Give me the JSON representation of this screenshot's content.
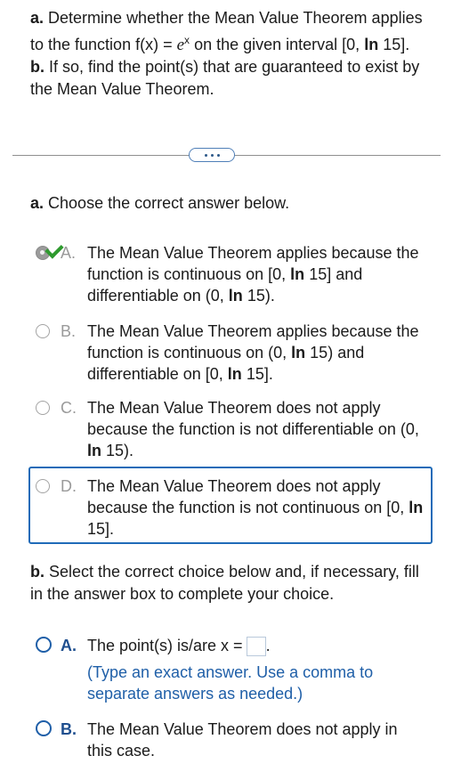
{
  "question": {
    "a_label": "a.",
    "a_text_1": "Determine whether the Mean Value Theorem applies to the function f(x) =",
    "a_func_base": "e",
    "a_func_exp": "x",
    "a_text_2": "on the given interval [0,",
    "a_ln": "ln",
    "a_text_3": "15].",
    "b_label": "b.",
    "b_text": "If so, find the point(s) that are guaranteed to exist by the Mean Value Theorem."
  },
  "part_a": {
    "prompt_label": "a.",
    "prompt_text": "Choose the correct answer below.",
    "options": [
      {
        "letter": "A.",
        "t1": "The Mean Value Theorem applies because the function is continuous on [0,",
        "ln1": "ln",
        "t2": "15] and differentiable on (0,",
        "ln2": "ln",
        "t3": "15)."
      },
      {
        "letter": "B.",
        "t1": "The Mean Value Theorem applies because the function is continuous on (0,",
        "ln1": "ln",
        "t2": "15) and differentiable on [0,",
        "ln2": "ln",
        "t3": "15]."
      },
      {
        "letter": "C.",
        "t1": "The Mean Value Theorem does not apply because the function is not differentiable on (0,",
        "ln1": "ln",
        "t2": "15)."
      },
      {
        "letter": "D.",
        "t1": "The Mean Value Theorem does not apply because the function is not continuous on [0,",
        "ln1": "ln",
        "t2": "15]."
      }
    ]
  },
  "part_b": {
    "prompt_label": "b.",
    "prompt_text": "Select the correct choice below and, if necessary, fill in the answer box to complete your choice.",
    "options": [
      {
        "letter": "A.",
        "text": "The point(s) is/are x =",
        "end": ".",
        "hint": "(Type an exact answer. Use a comma to separate answers as needed.)"
      },
      {
        "letter": "B.",
        "text": "The Mean Value Theorem does not apply in this case."
      }
    ]
  }
}
